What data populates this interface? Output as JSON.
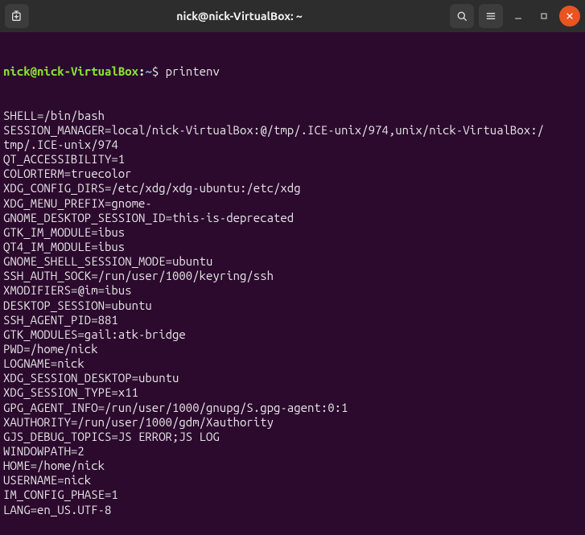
{
  "titlebar": {
    "title": "nick@nick-VirtualBox: ~"
  },
  "prompt": {
    "user": "nick",
    "at": "@",
    "host": "nick-VirtualBox",
    "colon": ":",
    "path": "~",
    "dollar": "$"
  },
  "command": "printenv",
  "output": [
    "SHELL=/bin/bash",
    "SESSION_MANAGER=local/nick-VirtualBox:@/tmp/.ICE-unix/974,unix/nick-VirtualBox:/tmp/.ICE-unix/974",
    "QT_ACCESSIBILITY=1",
    "COLORTERM=truecolor",
    "XDG_CONFIG_DIRS=/etc/xdg/xdg-ubuntu:/etc/xdg",
    "XDG_MENU_PREFIX=gnome-",
    "GNOME_DESKTOP_SESSION_ID=this-is-deprecated",
    "GTK_IM_MODULE=ibus",
    "QT4_IM_MODULE=ibus",
    "GNOME_SHELL_SESSION_MODE=ubuntu",
    "SSH_AUTH_SOCK=/run/user/1000/keyring/ssh",
    "XMODIFIERS=@im=ibus",
    "DESKTOP_SESSION=ubuntu",
    "SSH_AGENT_PID=881",
    "GTK_MODULES=gail:atk-bridge",
    "PWD=/home/nick",
    "LOGNAME=nick",
    "XDG_SESSION_DESKTOP=ubuntu",
    "XDG_SESSION_TYPE=x11",
    "GPG_AGENT_INFO=/run/user/1000/gnupg/S.gpg-agent:0:1",
    "XAUTHORITY=/run/user/1000/gdm/Xauthority",
    "GJS_DEBUG_TOPICS=JS ERROR;JS LOG",
    "WINDOWPATH=2",
    "HOME=/home/nick",
    "USERNAME=nick",
    "IM_CONFIG_PHASE=1",
    "LANG=en_US.UTF-8"
  ],
  "wrap_cols": 80
}
